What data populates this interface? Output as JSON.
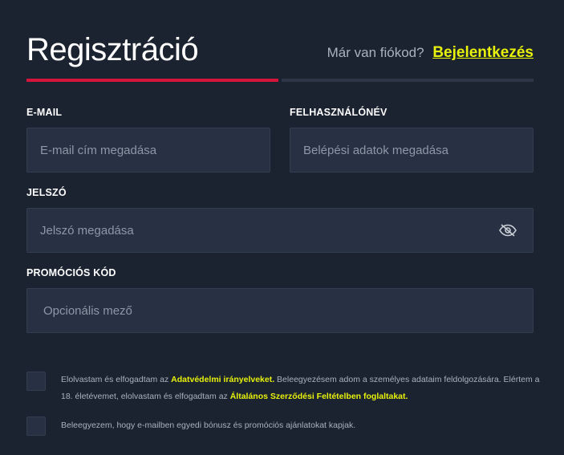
{
  "header": {
    "title": "Regisztráció",
    "login_question": "Már van fiókod?",
    "login_link": "Bejelentkezés"
  },
  "progress": {
    "step": 1,
    "total": 2,
    "active_color": "#d4143b",
    "inactive_color": "#2e3748"
  },
  "form": {
    "email": {
      "label": "E-MAIL",
      "placeholder": "E-mail cím megadása",
      "value": ""
    },
    "username": {
      "label": "FELHASZNÁLÓNÉV",
      "placeholder": "Belépési adatok megadása",
      "value": ""
    },
    "password": {
      "label": "JELSZÓ",
      "placeholder": "Jelszó megadása",
      "value": "",
      "toggle_icon": "eye-off-icon"
    },
    "promo": {
      "label": "PROMÓCIÓS KÓD",
      "placeholder": "Opcionális mező",
      "value": ""
    }
  },
  "consents": {
    "terms": {
      "checked": false,
      "text_1": "Elolvastam és elfogadtam az ",
      "link_1": "Adatvédelmi irányelveket.",
      "text_2": " Beleegyezésem adom a személyes adataim feldolgozására. Elértem a 18. életévemet, elolvastam és elfogadtam az ",
      "link_2": "Általános Szerződési Feltételben foglaltakat."
    },
    "marketing": {
      "checked": false,
      "text": "Beleegyezem, hogy e-mailben egyedi bónusz és promóciós ajánlatokat kapjak."
    }
  },
  "colors": {
    "background": "#1b2230",
    "field_bg": "#283143",
    "accent_yellow": "#e8f20a",
    "accent_red": "#d4143b"
  }
}
